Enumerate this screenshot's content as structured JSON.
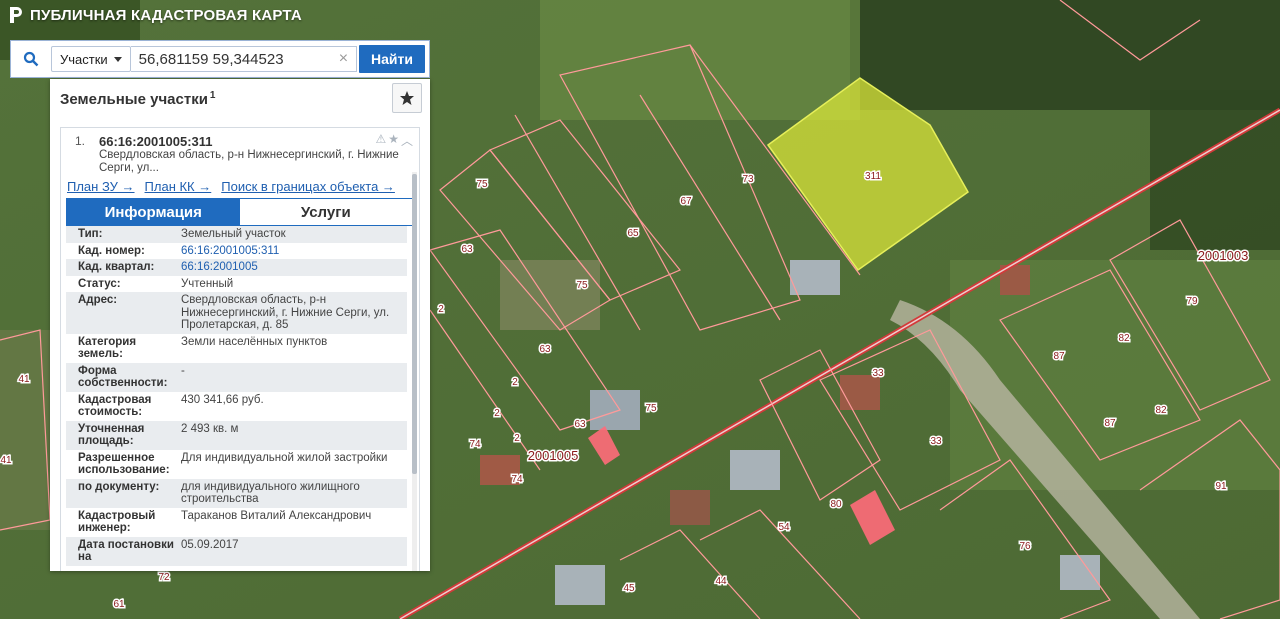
{
  "app": {
    "title": "ПУБЛИЧНАЯ КАДАСТРОВАЯ КАРТА"
  },
  "search": {
    "type_label": "Участки",
    "query": "56,681159 59,344523",
    "button_label": "Найти"
  },
  "panel": {
    "title": "Земельные участки",
    "count": "1"
  },
  "result": {
    "number": "1.",
    "id": "66:16:2001005:311",
    "address_short": "Свердловская область, р-н Нижнесергинский, г. Нижние Серги, ул...",
    "links": [
      "План ЗУ →",
      "План КК →",
      "Поиск в границах объекта →"
    ]
  },
  "tabs": {
    "info": "Информация",
    "services": "Услуги"
  },
  "info_rows": [
    {
      "k": "Тип:",
      "v": "Земельный участок",
      "link": false
    },
    {
      "k": "Кад. номер:",
      "v": "66:16:2001005:311",
      "link": true
    },
    {
      "k": "Кад. квартал:",
      "v": "66:16:2001005",
      "link": true
    },
    {
      "k": "Статус:",
      "v": "Учтенный",
      "link": false
    },
    {
      "k": "Адрес:",
      "v": "Свердловская область, р-н Нижнесергинский, г. Нижние Серги, ул. Пролетарская, д. 85",
      "link": false
    },
    {
      "k": "Категория земель:",
      "v": "Земли населённых пунктов",
      "link": false
    },
    {
      "k": "Форма собственности:",
      "v": "-",
      "link": false
    },
    {
      "k": "Кадастровая стоимость:",
      "v": "430 341,66 руб.",
      "link": false
    },
    {
      "k": "Уточненная площадь:",
      "v": "2 493 кв. м",
      "link": false
    },
    {
      "k": "Разрешенное использование:",
      "v": "Для индивидуальной жилой застройки",
      "link": false
    },
    {
      "k": "по документу:",
      "v": "для индивидуального жилищного строительства",
      "link": false
    },
    {
      "k": "Кадастровый инженер:",
      "v": "Тараканов Виталий Александрович",
      "link": false
    },
    {
      "k": "Дата постановки на",
      "v": "05.09.2017",
      "link": false
    }
  ],
  "map": {
    "selected_parcel": "311",
    "quarter_labels": [
      "2001005",
      "2001003"
    ],
    "parcel_labels": [
      "75",
      "67",
      "73",
      "65",
      "63",
      "75",
      "63",
      "2",
      "2",
      "2",
      "74",
      "2",
      "63",
      "75",
      "74",
      "41",
      "41",
      "33",
      "33",
      "87",
      "82",
      "82",
      "87",
      "79",
      "91",
      "80",
      "54",
      "76",
      "44",
      "45",
      "72",
      "61"
    ],
    "colors": {
      "boundary": "#ff9a9a",
      "road": "#d33a3a",
      "selected_fill": "#d8e43a",
      "highlight_fill": "#ff6b7a",
      "label_bg": "#ffffff",
      "label_text": "#8a1a1a"
    }
  }
}
